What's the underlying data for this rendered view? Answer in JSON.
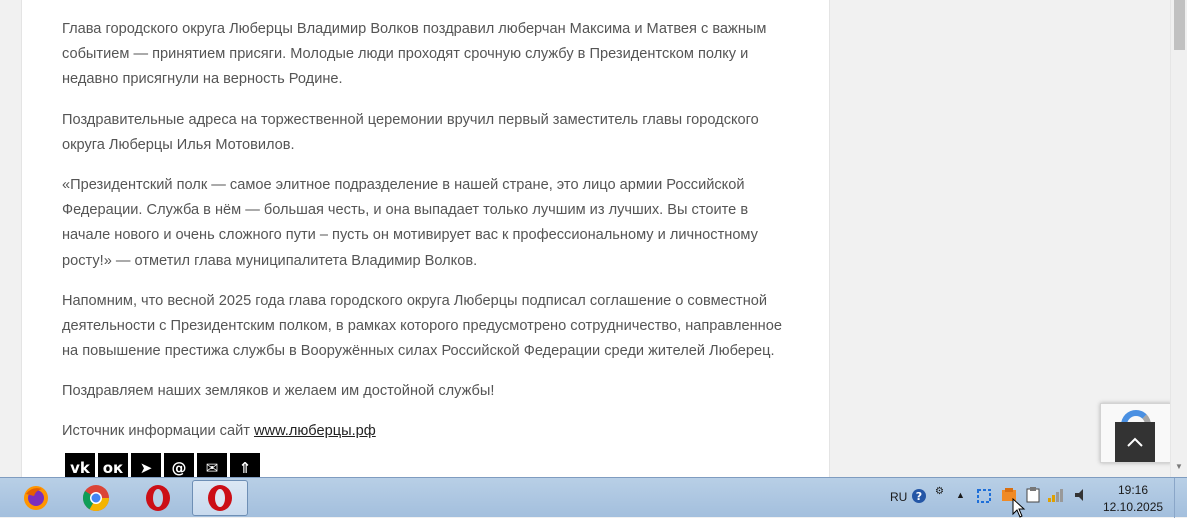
{
  "article": {
    "paragraphs": [
      "Глава городского округа Люберцы Владимир Волков поздравил люберчан Максима и Матвея с важным событием — принятием присяги. Молодые люди проходят срочную службу в Президентском полку и недавно присягнули на верность Родине.",
      "Поздравительные адреса на торжественной церемонии вручил первый заместитель главы городского округа Люберцы Илья Мотовилов.",
      "«Президентский полк — самое элитное подразделение в нашей стране, это лицо армии Российской Федерации. Служба в нём — большая честь, и она выпадает только лучшим из лучших. Вы стоите в начале нового и очень сложного пути – пусть он мотивирует вас к профессиональному и личностному росту!» — отметил глава муниципалитета Владимир Волков.",
      "Напомним, что весной 2025 года глава городского округа Люберцы подписал соглашение о совместной деятельности с Президентским полком, в рамках которого предусмотрено сотрудничество, направленное на повышение престижа службы в Вооружённых силах Российской Федерации среди жителей Люберец.",
      "Поздравляем наших земляков и желаем им достойной службы!"
    ],
    "source_prefix": "Источник информации сайт ",
    "source_link": "www.люберцы.рф",
    "share_buttons": [
      {
        "icon": "vk-icon",
        "glyph": "vk"
      },
      {
        "icon": "odnoklassniki-icon",
        "glyph": "ок"
      },
      {
        "icon": "telegram-icon",
        "glyph": "➤"
      },
      {
        "icon": "mail-ru-icon",
        "glyph": "@"
      },
      {
        "icon": "email-icon",
        "glyph": "✉"
      },
      {
        "icon": "more-share-icon",
        "glyph": "⇑"
      }
    ]
  },
  "taskbar": {
    "apps": [
      {
        "name": "firefox-icon",
        "color": "#e66000"
      },
      {
        "name": "chrome-icon",
        "color": "#4285f4"
      },
      {
        "name": "opera-icon",
        "color": "#cc0f16"
      },
      {
        "name": "opera-icon-active",
        "color": "#cc0f16"
      }
    ],
    "tray": {
      "language": "RU"
    },
    "clock": {
      "time": "19:16",
      "date": "12.10.2025"
    }
  },
  "colors": {
    "text": "#555555",
    "to_top_bg": "#333333",
    "taskbar": "#a3bfdd"
  }
}
